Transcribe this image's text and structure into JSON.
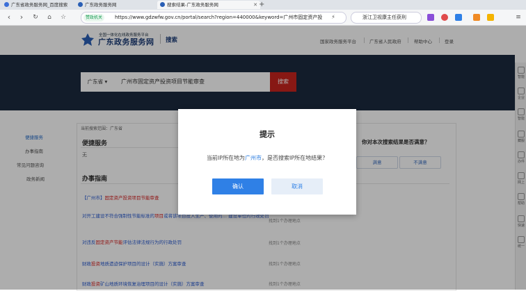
{
  "browser": {
    "tabs": [
      {
        "label": "广东省政务服务网_百度搜索",
        "active": false
      },
      {
        "label": "广东政务服务网",
        "active": false
      },
      {
        "label": "搜索结果-广东政务服务网",
        "active": true
      }
    ],
    "new_tab": "+",
    "security_tag": "赞政机关",
    "url": "https://www.gdzwfw.gov.cn/portal/search?region=440000&keyword=广州市固定资产投",
    "search_text": "浙江卫视康主任获刑"
  },
  "header": {
    "logo_small": "全国一体化在线政务服务平台",
    "logo_big": "广东政务服务网",
    "section": "搜索",
    "links": [
      "国家政务服务平台",
      "广东省人民政府",
      "帮助中心",
      "登录"
    ]
  },
  "search": {
    "region": "广东省 ▾",
    "query": "广州市固定资产投资项目节能审查",
    "button": "搜索"
  },
  "sidebar": [
    "便捷服务",
    "办事指南",
    "常见问题咨询",
    "政务新闻"
  ],
  "content": {
    "range": "当前搜索范围：广东省",
    "convenient_title": "便捷服务",
    "convenient_empty": "无",
    "guide_title": "办事指南",
    "items": [
      {
        "prefix": "【广州市】",
        "hl": "固定资产投资项目节能审查",
        "suffix": "",
        "find": ""
      },
      {
        "prefix": "对开工建设不符合强制性节能标准的",
        "hl": "项目",
        "suffix": "或将该项目投入生产、使用的… 建设单位的行政处罚",
        "find": "找到1个办理地点"
      },
      {
        "prefix": "对违反",
        "hl": "固定资产节能",
        "suffix": "评估法律法规行为的行政处罚",
        "find": "找到1个办理地点"
      },
      {
        "prefix": "财政",
        "hl": "投资",
        "suffix": "地质遗迹保护项目的设计（实施）方案审查",
        "find": "找到1个办理地点"
      },
      {
        "prefix": "财政",
        "hl": "投资",
        "suffix": "矿山地质环境恢复治理项目的设计（实施）方案审查",
        "find": "找到1个办理地点"
      }
    ]
  },
  "satisfaction": {
    "title": "你对本次搜索结果是否满意？",
    "yes": "满意",
    "no": "不满意"
  },
  "right_toolbar": [
    "智能",
    "企业",
    "智能",
    "藏服",
    "办件",
    "网上",
    "帮助",
    "快速",
    "统一"
  ],
  "modal": {
    "title": "提示",
    "msg_before": "当前IP所在地为",
    "city": "广州市",
    "msg_after": "，是否搜索IP所在地结果？",
    "confirm": "确认",
    "cancel": "取消"
  },
  "colors": {
    "banner": "#1b2a3f",
    "search_button": "#c8241e",
    "confirm_button": "#2f80e6",
    "link": "#2a5bd0",
    "highlight": "#d42020"
  }
}
